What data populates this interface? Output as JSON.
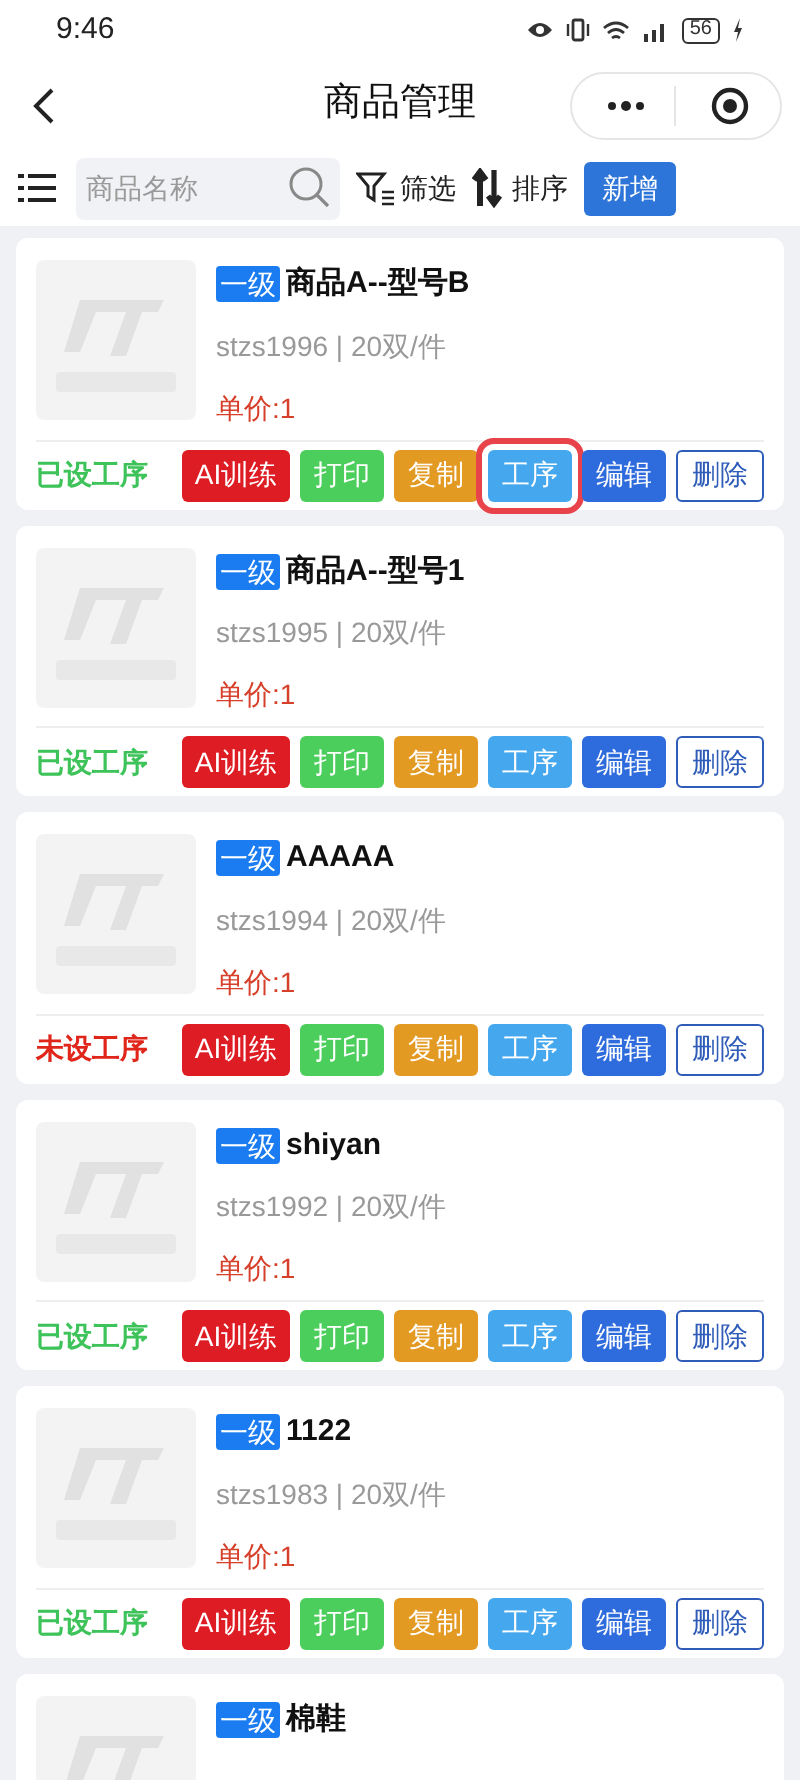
{
  "status_bar": {
    "time": "9:46",
    "battery": "56"
  },
  "nav": {
    "title": "商品管理"
  },
  "toolbar": {
    "search_placeholder": "商品名称",
    "filter": "筛选",
    "sort": "排序",
    "add": "新增"
  },
  "products": [
    {
      "level": "一级",
      "name": "商品A--型号B",
      "spec": "stzs1996 | 20双/件",
      "price": "单价:1",
      "process_set": true,
      "process_label": "已设工序",
      "buttons": [
        {
          "kind": "ai",
          "label": "AI训练",
          "highlighted": false
        },
        {
          "kind": "print",
          "label": "打印",
          "highlighted": false
        },
        {
          "kind": "copy",
          "label": "复制",
          "highlighted": false
        },
        {
          "kind": "process",
          "label": "工序",
          "highlighted": true
        },
        {
          "kind": "edit",
          "label": "编辑",
          "highlighted": false
        },
        {
          "kind": "delete",
          "label": "删除",
          "highlighted": false
        }
      ]
    },
    {
      "level": "一级",
      "name": "商品A--型号1",
      "spec": "stzs1995 | 20双/件",
      "price": "单价:1",
      "process_set": true,
      "process_label": "已设工序",
      "buttons": [
        {
          "kind": "ai",
          "label": "AI训练",
          "highlighted": false
        },
        {
          "kind": "print",
          "label": "打印",
          "highlighted": false
        },
        {
          "kind": "copy",
          "label": "复制",
          "highlighted": false
        },
        {
          "kind": "process",
          "label": "工序",
          "highlighted": false
        },
        {
          "kind": "edit",
          "label": "编辑",
          "highlighted": false
        },
        {
          "kind": "delete",
          "label": "删除",
          "highlighted": false
        }
      ]
    },
    {
      "level": "一级",
      "name": "AAAAA",
      "spec": "stzs1994 | 20双/件",
      "price": "单价:1",
      "process_set": false,
      "process_label": "未设工序",
      "buttons": [
        {
          "kind": "ai",
          "label": "AI训练",
          "highlighted": false
        },
        {
          "kind": "print",
          "label": "打印",
          "highlighted": false
        },
        {
          "kind": "copy",
          "label": "复制",
          "highlighted": false
        },
        {
          "kind": "process",
          "label": "工序",
          "highlighted": false
        },
        {
          "kind": "edit",
          "label": "编辑",
          "highlighted": false
        },
        {
          "kind": "delete",
          "label": "删除",
          "highlighted": false
        }
      ]
    },
    {
      "level": "一级",
      "name": "shiyan",
      "spec": "stzs1992 | 20双/件",
      "price": "单价:1",
      "process_set": true,
      "process_label": "已设工序",
      "buttons": [
        {
          "kind": "ai",
          "label": "AI训练",
          "highlighted": false
        },
        {
          "kind": "print",
          "label": "打印",
          "highlighted": false
        },
        {
          "kind": "copy",
          "label": "复制",
          "highlighted": false
        },
        {
          "kind": "process",
          "label": "工序",
          "highlighted": false
        },
        {
          "kind": "edit",
          "label": "编辑",
          "highlighted": false
        },
        {
          "kind": "delete",
          "label": "删除",
          "highlighted": false
        }
      ]
    },
    {
      "level": "一级",
      "name": "1122",
      "spec": "stzs1983 | 20双/件",
      "price": "单价:1",
      "process_set": true,
      "process_label": "已设工序",
      "buttons": [
        {
          "kind": "ai",
          "label": "AI训练",
          "highlighted": false
        },
        {
          "kind": "print",
          "label": "打印",
          "highlighted": false
        },
        {
          "kind": "copy",
          "label": "复制",
          "highlighted": false
        },
        {
          "kind": "process",
          "label": "工序",
          "highlighted": false
        },
        {
          "kind": "edit",
          "label": "编辑",
          "highlighted": false
        },
        {
          "kind": "delete",
          "label": "删除",
          "highlighted": false
        }
      ]
    },
    {
      "level": "一级",
      "name": "棉鞋"
    }
  ]
}
